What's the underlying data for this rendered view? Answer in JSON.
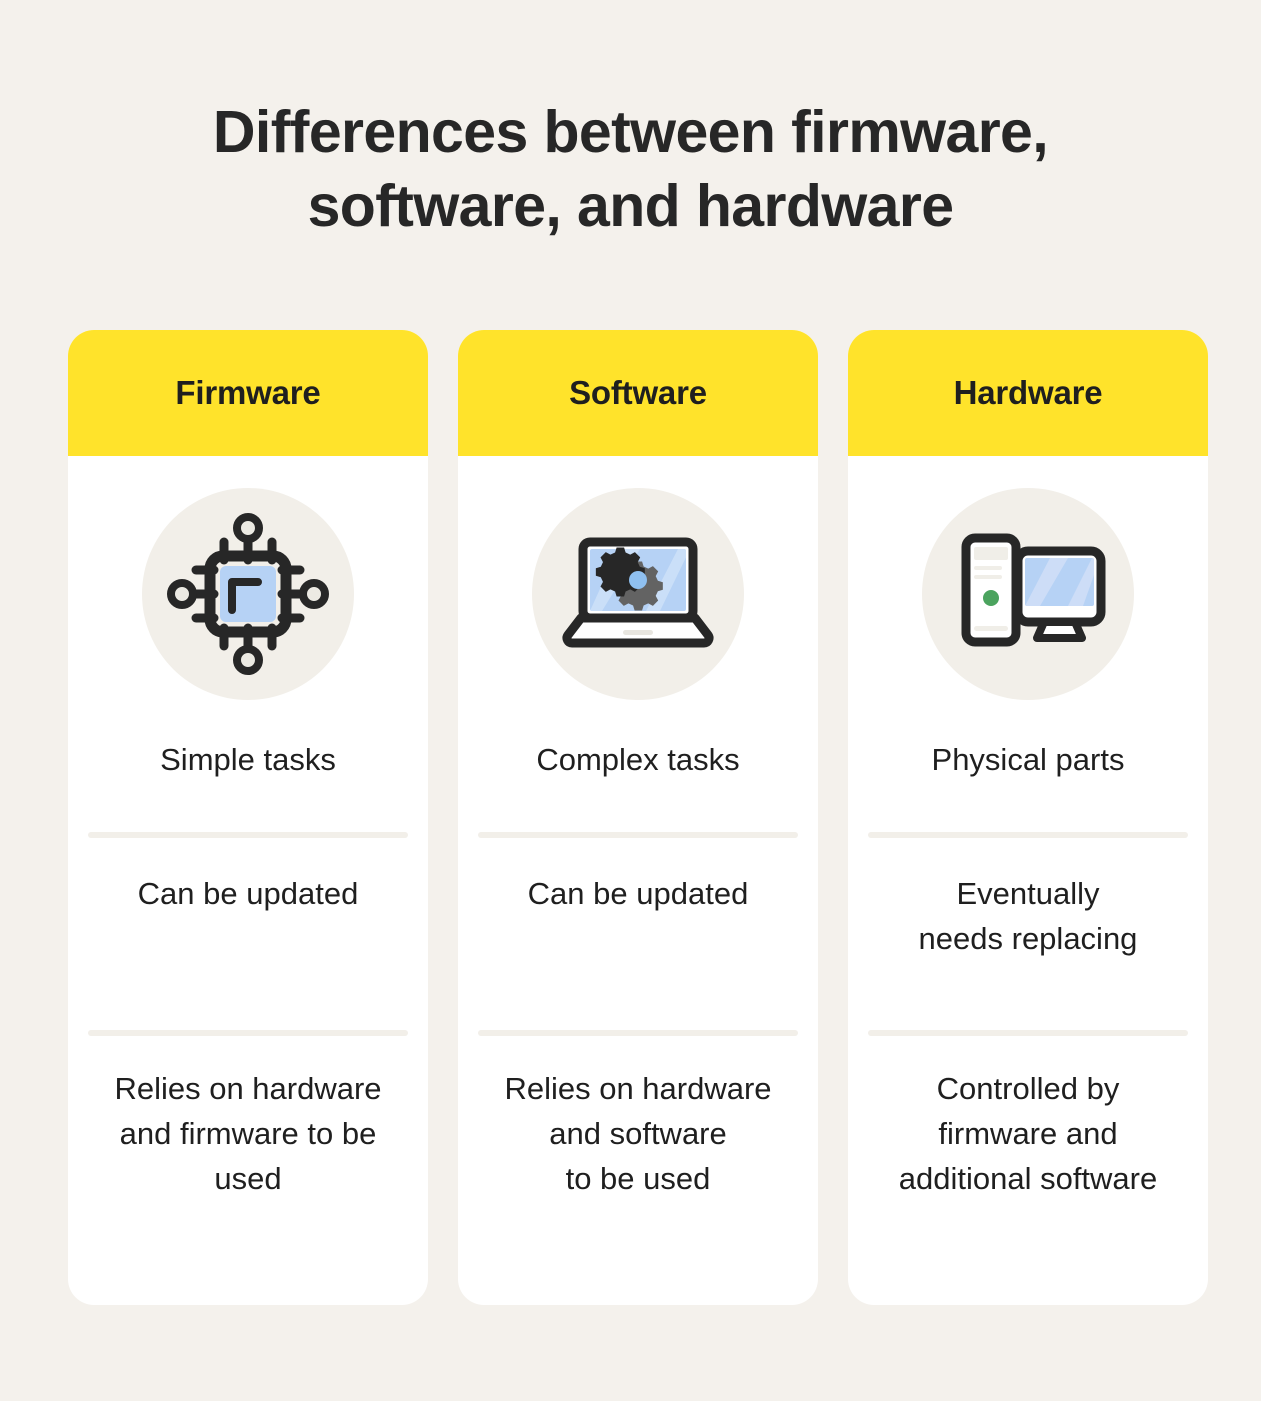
{
  "title": {
    "line1": "Differences between firmware,",
    "line2": "software, and hardware"
  },
  "colors": {
    "page_background": "#f4f1ec",
    "card_background": "#ffffff",
    "header_yellow": "#ffe32b",
    "text_dark": "#1f1f1f",
    "divider": "#f2efe9",
    "icon_circle": "#f2efe9",
    "accent_blue": "#b6d2f5",
    "accent_green": "#4ba35e",
    "icon_dark": "#272727",
    "gear_gray": "#636363"
  },
  "columns": [
    {
      "header": "Firmware",
      "icon": "microchip-icon",
      "rows": [
        "Simple tasks",
        "Can be updated",
        "Relies on hardware\nand firmware to be\nused"
      ]
    },
    {
      "header": "Software",
      "icon": "laptop-gear-icon",
      "rows": [
        "Complex tasks",
        "Can be updated",
        "Relies on hardware\nand software\nto be used"
      ]
    },
    {
      "header": "Hardware",
      "icon": "desktop-computer-icon",
      "rows": [
        "Physical parts",
        "Eventually\nneeds replacing",
        "Controlled by\nfirmware and\nadditional software"
      ]
    }
  ]
}
